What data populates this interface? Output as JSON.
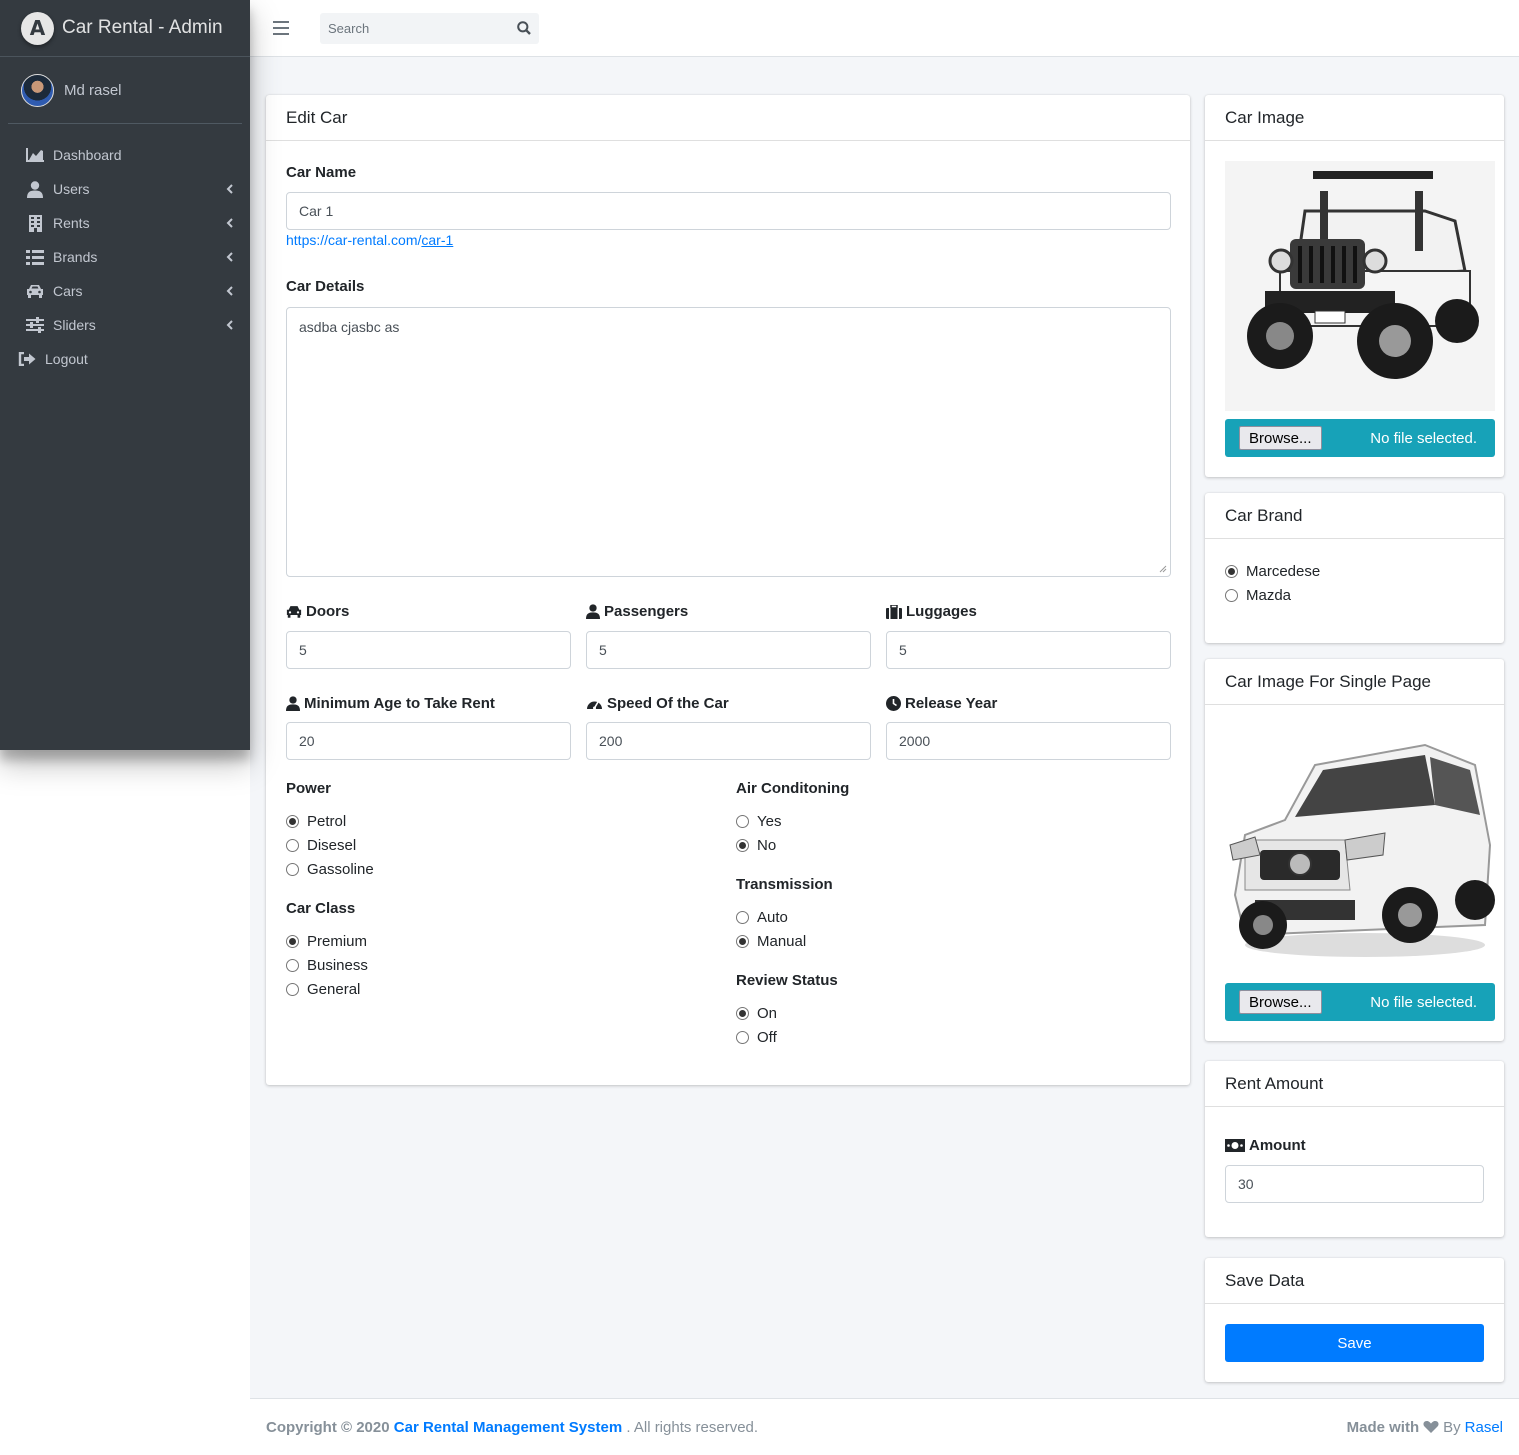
{
  "brand": {
    "logo_letter": "A",
    "title": "Car Rental - Admin"
  },
  "user": {
    "name": "Md rasel"
  },
  "nav": [
    {
      "label": "Dashboard",
      "icon": "chart-area-icon",
      "has_children": false
    },
    {
      "label": "Users",
      "icon": "user-icon",
      "has_children": true
    },
    {
      "label": "Rents",
      "icon": "building-icon",
      "has_children": true
    },
    {
      "label": "Brands",
      "icon": "list-icon",
      "has_children": true
    },
    {
      "label": "Cars",
      "icon": "car-icon",
      "has_children": true
    },
    {
      "label": "Sliders",
      "icon": "sliders-icon",
      "has_children": true
    },
    {
      "label": "Logout",
      "icon": "sign-out-icon",
      "has_children": false
    }
  ],
  "header": {
    "search_placeholder": "Search"
  },
  "edit_car": {
    "title": "Edit Car",
    "car_name_label": "Car Name",
    "car_name_value": "Car 1",
    "slug_prefix": "https://car-rental.com/",
    "slug": "car-1",
    "car_details_label": "Car Details",
    "car_details_value": "asdba cjasbc as",
    "doors_label": "Doors",
    "doors_value": "5",
    "passengers_label": "Passengers",
    "passengers_value": "5",
    "luggages_label": "Luggages",
    "luggages_value": "5",
    "min_age_label": "Minimum Age to Take Rent",
    "min_age_value": "20",
    "speed_label": "Speed Of the Car",
    "speed_value": "200",
    "release_label": "Release Year",
    "release_value": "2000",
    "power": {
      "label": "Power",
      "options": [
        "Petrol",
        "Disesel",
        "Gassoline"
      ],
      "selected": 0
    },
    "car_class": {
      "label": "Car Class",
      "options": [
        "Premium",
        "Business",
        "General"
      ],
      "selected": 0
    },
    "air": {
      "label": "Air Conditoning",
      "options": [
        "Yes",
        "No"
      ],
      "selected": 1
    },
    "transmission": {
      "label": "Transmission",
      "options": [
        "Auto",
        "Manual"
      ],
      "selected": 1
    },
    "review": {
      "label": "Review Status",
      "options": [
        "On",
        "Off"
      ],
      "selected": 0
    }
  },
  "car_image": {
    "title": "Car Image",
    "browse": "Browse...",
    "no_file": "No file selected."
  },
  "car_brand": {
    "title": "Car Brand",
    "options": [
      "Marcedese",
      "Mazda"
    ],
    "selected": 0
  },
  "single_image": {
    "title": "Car Image For Single Page",
    "browse": "Browse...",
    "no_file": "No file selected."
  },
  "rent": {
    "title": "Rent Amount",
    "label": "Amount",
    "value": "30"
  },
  "save": {
    "title": "Save Data",
    "button": "Save"
  },
  "footer": {
    "copyright": "Copyright © 2020",
    "system": "Car Rental Management System",
    "rights": ". All rights reserved.",
    "made_with": "Made with",
    "by": "By",
    "author": "Rasel"
  },
  "colors": {
    "sidebar": "#343a40",
    "primary": "#007bff",
    "info": "#17a2b8",
    "background": "#f4f6f9"
  }
}
